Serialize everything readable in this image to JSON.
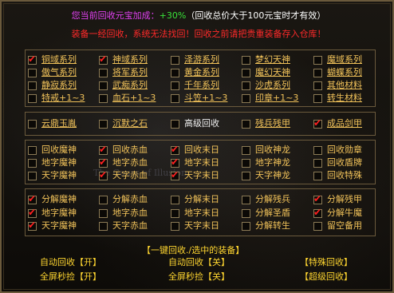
{
  "header": {
    "line1_prefix": "您当前回收元宝加成：",
    "line1_bonus": "+30%",
    "line1_suffix": "（回收总价大于100元宝时才有效）",
    "line2": "装备一经回收，系统无法找回！回收之前请把贵重装备存入仓库！"
  },
  "watermark": "The Gauss of Illusion",
  "series": [
    {
      "label": "铜域系列",
      "checked": true
    },
    {
      "label": "神域系列",
      "checked": true
    },
    {
      "label": "泽游系列",
      "checked": false
    },
    {
      "label": "梦幻天神",
      "checked": false
    },
    {
      "label": "魔域系列",
      "checked": false
    },
    {
      "label": "傲气系列",
      "checked": false
    },
    {
      "label": "将军系列",
      "checked": false
    },
    {
      "label": "黄金系列",
      "checked": false
    },
    {
      "label": "魔幻天神",
      "checked": false
    },
    {
      "label": "蝴蝶系列",
      "checked": false
    },
    {
      "label": "静寂系列",
      "checked": false
    },
    {
      "label": "武痴系列",
      "checked": false
    },
    {
      "label": "千年系列",
      "checked": false
    },
    {
      "label": "沙虎系列",
      "checked": false
    },
    {
      "label": "其他材料",
      "checked": false
    },
    {
      "label": "特戒+1~3",
      "checked": false
    },
    {
      "label": "血石+1~3",
      "checked": false
    },
    {
      "label": "斗笠+1~3",
      "checked": false
    },
    {
      "label": "印章+1~3",
      "checked": false
    },
    {
      "label": "转生材料",
      "checked": false
    }
  ],
  "special": [
    {
      "label": "云鼎玉胤",
      "checked": false
    },
    {
      "label": "沉默之石",
      "checked": false
    },
    {
      "label": "高级回收",
      "checked": false
    },
    {
      "label": "残兵残甲",
      "checked": false
    },
    {
      "label": "成品剑甲",
      "checked": true
    }
  ],
  "recycle": [
    {
      "label": "回收魔神",
      "checked": false
    },
    {
      "label": "回收赤血",
      "checked": true
    },
    {
      "label": "回收末日",
      "checked": true
    },
    {
      "label": "回收神龙",
      "checked": false
    },
    {
      "label": "回收勋章",
      "checked": false
    },
    {
      "label": "地字魔神",
      "checked": false
    },
    {
      "label": "地字赤血",
      "checked": true
    },
    {
      "label": "地字末日",
      "checked": true
    },
    {
      "label": "地字神龙",
      "checked": false
    },
    {
      "label": "回收盾牌",
      "checked": false
    },
    {
      "label": "天字魔神",
      "checked": false
    },
    {
      "label": "天字赤血",
      "checked": true
    },
    {
      "label": "天字末日",
      "checked": true
    },
    {
      "label": "天字神龙",
      "checked": false
    },
    {
      "label": "回收特殊",
      "checked": false
    }
  ],
  "decompose": [
    {
      "label": "分解魔神",
      "checked": true
    },
    {
      "label": "分解赤血",
      "checked": false
    },
    {
      "label": "分解末日",
      "checked": false
    },
    {
      "label": "分解残兵",
      "checked": false
    },
    {
      "label": "分解残甲",
      "checked": true
    },
    {
      "label": "地字魔神",
      "checked": true
    },
    {
      "label": "地字赤血",
      "checked": false
    },
    {
      "label": "地字末日",
      "checked": false
    },
    {
      "label": "分解圣盾",
      "checked": false
    },
    {
      "label": "分解牛魔",
      "checked": true
    },
    {
      "label": "天字魔神",
      "checked": true
    },
    {
      "label": "天字赤血",
      "checked": false
    },
    {
      "label": "天字末日",
      "checked": false
    },
    {
      "label": "分解转生",
      "checked": false
    },
    {
      "label": "留空备用",
      "checked": false
    }
  ],
  "buttons": {
    "recycle_selected": "【一键回收./选中的装备】",
    "auto_recycle": "自动回收【开】",
    "auto_recycle2": "自动回收【关】",
    "special_recycle": "【特殊回收】",
    "fullscreen_pick": "全屏秒捡【开】",
    "fullscreen_pick2": "全屏秒捡【关】",
    "super_recycle": "【超级回收】"
  }
}
